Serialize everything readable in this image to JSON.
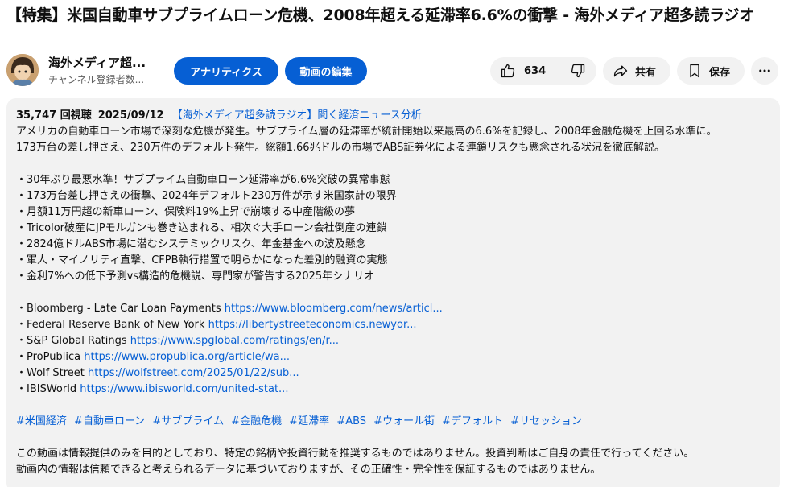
{
  "video": {
    "title": "【特集】米国自動車サブプライムローン危機、2008年超える延滞率6.6%の衝撃 - 海外メディア超多読ラジオ"
  },
  "channel": {
    "name": "海外メディア超...",
    "subscribers": "チャンネル登録者数..."
  },
  "actions": {
    "analytics_label": "アナリティクス",
    "edit_label": "動画の編集",
    "like_count": "634",
    "share_label": "共有",
    "save_label": "保存"
  },
  "description": {
    "views": "35,747 回視聴",
    "date": "2025/09/12",
    "hashtag_header": "【海外メディア超多読ラジオ】聞く経済ニュース分析",
    "intro_lines": [
      "アメリカの自動車ローン市場で深刻な危機が発生。サブプライム層の延滞率が統計開始以来最高の6.6%を記録し、2008年金融危機を上回る水準に。",
      "173万台の差し押さえ、230万件のデフォルト発生。総額1.66兆ドルの市場でABS証券化による連鎖リスクも懸念される状況を徹底解説。"
    ],
    "bullets": [
      "・30年ぶり最悪水準！サブプライム自動車ローン延滞率が6.6%突破の異常事態",
      "・173万台差し押さえの衝撃、2024年デフォルト230万件が示す米国家計の限界",
      "・月額11万円超の新車ローン、保険料19%上昇で崩壊する中産階級の夢",
      "・Tricolor破産にJPモルガンも巻き込まれる、相次ぐ大手ローン会社倒産の連鎖",
      "・2824億ドルABS市場に潜むシステミックリスク、年金基金への波及懸念",
      "・軍人・マイノリティ直撃、CFPB執行措置で明らかになった差別的融資の実態",
      "・金利7%への低下予測vs構造的危機説、専門家が警告する2025年シナリオ"
    ],
    "sources": [
      {
        "label": "・Bloomberg - Late Car Loan Payments ",
        "url": "https://www.bloomberg.com/news/articl..."
      },
      {
        "label": "・Federal Reserve Bank of New York ",
        "url": "https://libertystreeteconomics.newyor..."
      },
      {
        "label": "・S&P Global Ratings ",
        "url": "https://www.spglobal.com/ratings/en/r..."
      },
      {
        "label": "・ProPublica ",
        "url": "https://www.propublica.org/article/wa..."
      },
      {
        "label": "・Wolf Street ",
        "url": "https://wolfstreet.com/2025/01/22/sub..."
      },
      {
        "label": "・IBISWorld ",
        "url": "https://www.ibisworld.com/united-stat..."
      }
    ],
    "hashtags": [
      "#米国経済",
      "#自動車ローン",
      "#サブプライム",
      "#金融危機",
      "#延滞率",
      "#ABS",
      "#ウォール街",
      "#デフォルト",
      "#リセッション"
    ],
    "disclaimer_lines": [
      "この動画は情報提供のみを目的としており、特定の銘柄や投資行動を推奨するものではありません。投資判断はご自身の責任で行ってください。",
      "動画内の情報は信頼できると考えられるデータに基づいておりますが、その正確性・完全性を保証するものではありません。"
    ]
  },
  "icons": {
    "like": "thumbs-up-icon",
    "dislike": "thumbs-down-icon",
    "share": "share-arrow-icon",
    "save": "bookmark-icon",
    "more": "more-dots-icon"
  },
  "colors": {
    "accent": "#065fd4",
    "pill_bg": "#f2f2f2",
    "text": "#0f0f0f",
    "secondary_text": "#606060"
  }
}
